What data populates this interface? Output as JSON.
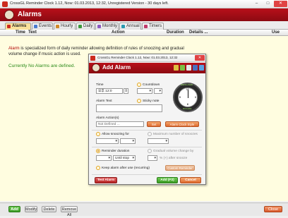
{
  "window": {
    "title": "CrossGL Reminder Clock 1.12, Now: 01.03.2013, 12:32, Unregistered Version - 30 days left.",
    "min": "–",
    "max": "□",
    "close": "✕"
  },
  "header": {
    "title": "Alarms"
  },
  "tabs": [
    {
      "label": "Alarms",
      "color": "#cc2b1f"
    },
    {
      "label": "Events",
      "color": "#4a7bd0"
    },
    {
      "label": "Hourly",
      "color": "#d08a2a"
    },
    {
      "label": "Daily",
      "color": "#3c9a3c"
    },
    {
      "label": "Monthly",
      "color": "#8a5ac0"
    },
    {
      "label": "Annual",
      "color": "#2a9ab0"
    },
    {
      "label": "Timers",
      "color": "#c03a6a"
    }
  ],
  "columns": {
    "time": "Time",
    "text": "Text",
    "action": "Action",
    "duration": "Duration",
    "details": "Details ...",
    "use": "Use"
  },
  "content": {
    "desc_highlight": "Alarm",
    "desc_rest": " is specialized form of daily reminder allowing definition of rules of snoozing and gradual volume change if music action is used.",
    "no_alarms": "Currently No Alarms are defined."
  },
  "bottom_buttons": {
    "add": "Add",
    "modify": "Modify",
    "delete": "Delete",
    "remove_all": "Remove All",
    "close": "Close"
  },
  "dialog": {
    "title": "CrossGL Reminder Clock 1.12, Now: 01.03.2013, 12:32",
    "close": "✕",
    "header_title": "Add Alarm",
    "time_label": "Time",
    "time_ampm": "오후",
    "time_hour": "12",
    "time_minute": "0",
    "countdown_label": "Countdown",
    "alarm_text_label": "Alarm Text",
    "sticky_note_label": "Sticky note",
    "alarm_actions_label": "Alarm Action(s)",
    "action_value": "Not Defined ...",
    "set_button": "Set",
    "alarm_clock_style_button": "Alarm Clock Style",
    "allow_snoozing_label": "Allow snoozing for",
    "max_snoozes_label": "Maximum number of snoozes",
    "reminder_duration_label": "Reminder duration",
    "until_stop_value": "Until stop",
    "gradual_volume_label": "Gradual volume change by",
    "after_snooze_label": "% (+) after snooze",
    "keep_alarm_label": "Keep alarm after use (recurring)",
    "custom_reminder_button": "Custom Reminder",
    "test_alarm_button": "Test Alarm",
    "add_button": "Add (F2)",
    "cancel_button": "Cancel",
    "clock_ring_top": "Alarm clock",
    "clock_ring_bottom": "CrossGL"
  }
}
